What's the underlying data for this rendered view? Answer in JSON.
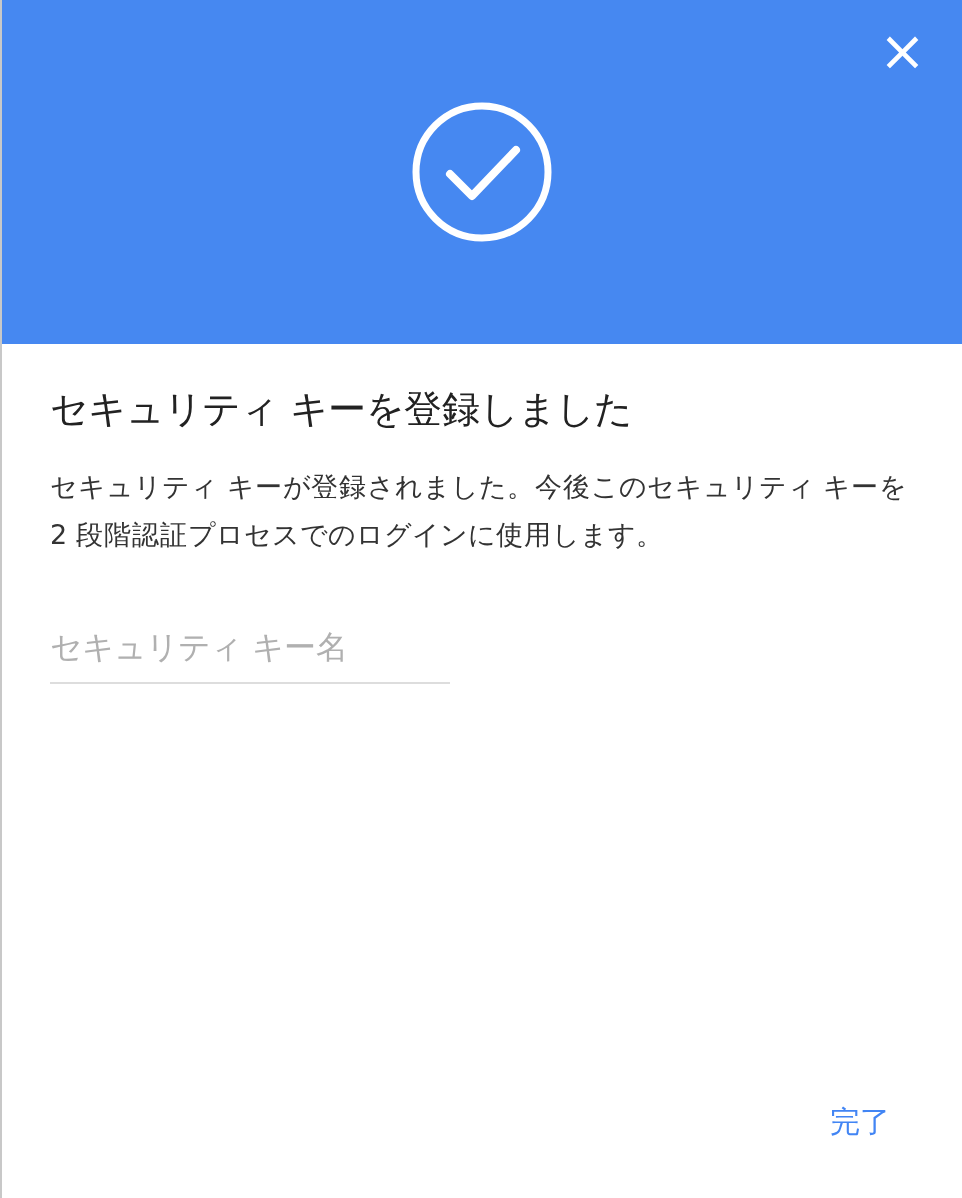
{
  "header": {
    "close": "×"
  },
  "title": "セキュリティ キーを登録しました",
  "message": "セキュリティ キーが登録されました。今後このセキュリティ キーを 2 段階認証プロセスでのログインに使用します。",
  "name_field": {
    "placeholder": "セキュリティ キー名"
  },
  "buttons": [
    "完了"
  ]
}
